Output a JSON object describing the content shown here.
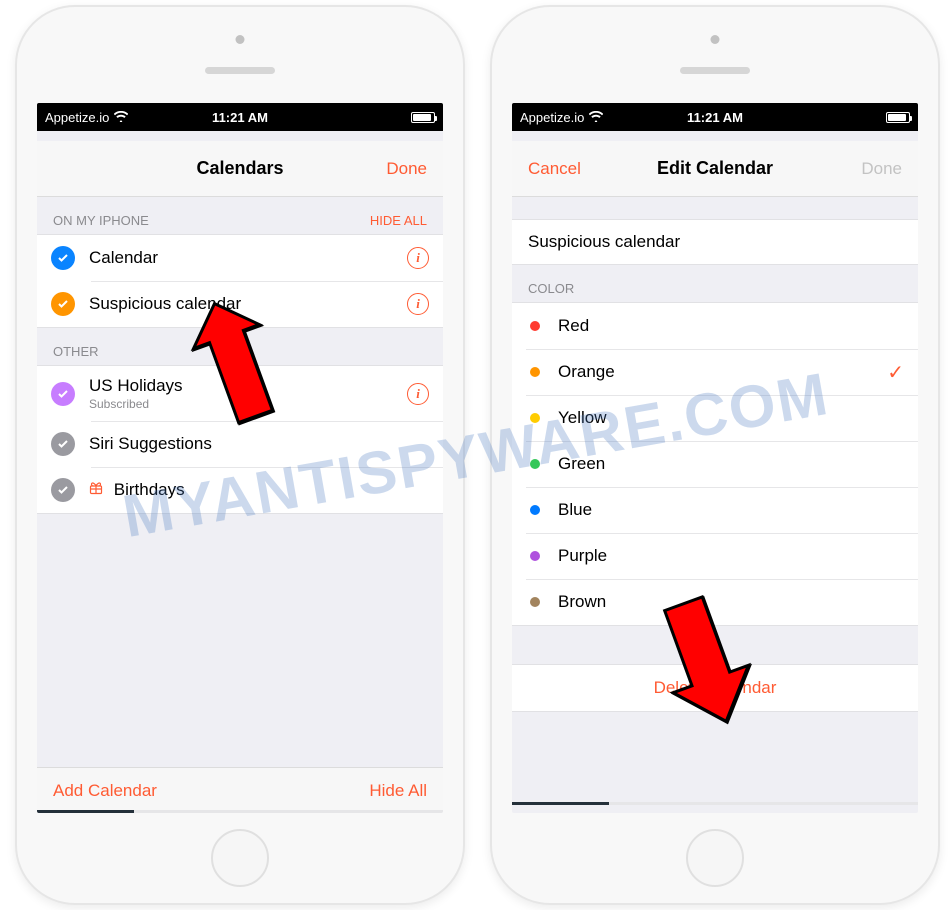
{
  "status": {
    "carrier": "Appetize.io",
    "time": "11:21 AM"
  },
  "watermark": "MYANTISPYWARE.COM",
  "left": {
    "nav_title": "Calendars",
    "nav_done": "Done",
    "section1_header": "ON MY IPHONE",
    "hide_all": "HIDE ALL",
    "cal1": "Calendar",
    "cal2": "Suspicious calendar",
    "section2_header": "OTHER",
    "other1": "US Holidays",
    "other1_sub": "Subscribed",
    "other2": "Siri Suggestions",
    "other3": "Birthdays",
    "toolbar_add": "Add Calendar",
    "toolbar_hide": "Hide All"
  },
  "right": {
    "nav_cancel": "Cancel",
    "nav_title": "Edit Calendar",
    "nav_done": "Done",
    "calendar_name": "Suspicious calendar",
    "color_header": "COLOR",
    "colors": {
      "red": "Red",
      "orange": "Orange",
      "yellow": "Yellow",
      "green": "Green",
      "blue": "Blue",
      "purple": "Purple",
      "brown": "Brown"
    },
    "selected_color": "orange",
    "delete": "Delete Calendar"
  }
}
